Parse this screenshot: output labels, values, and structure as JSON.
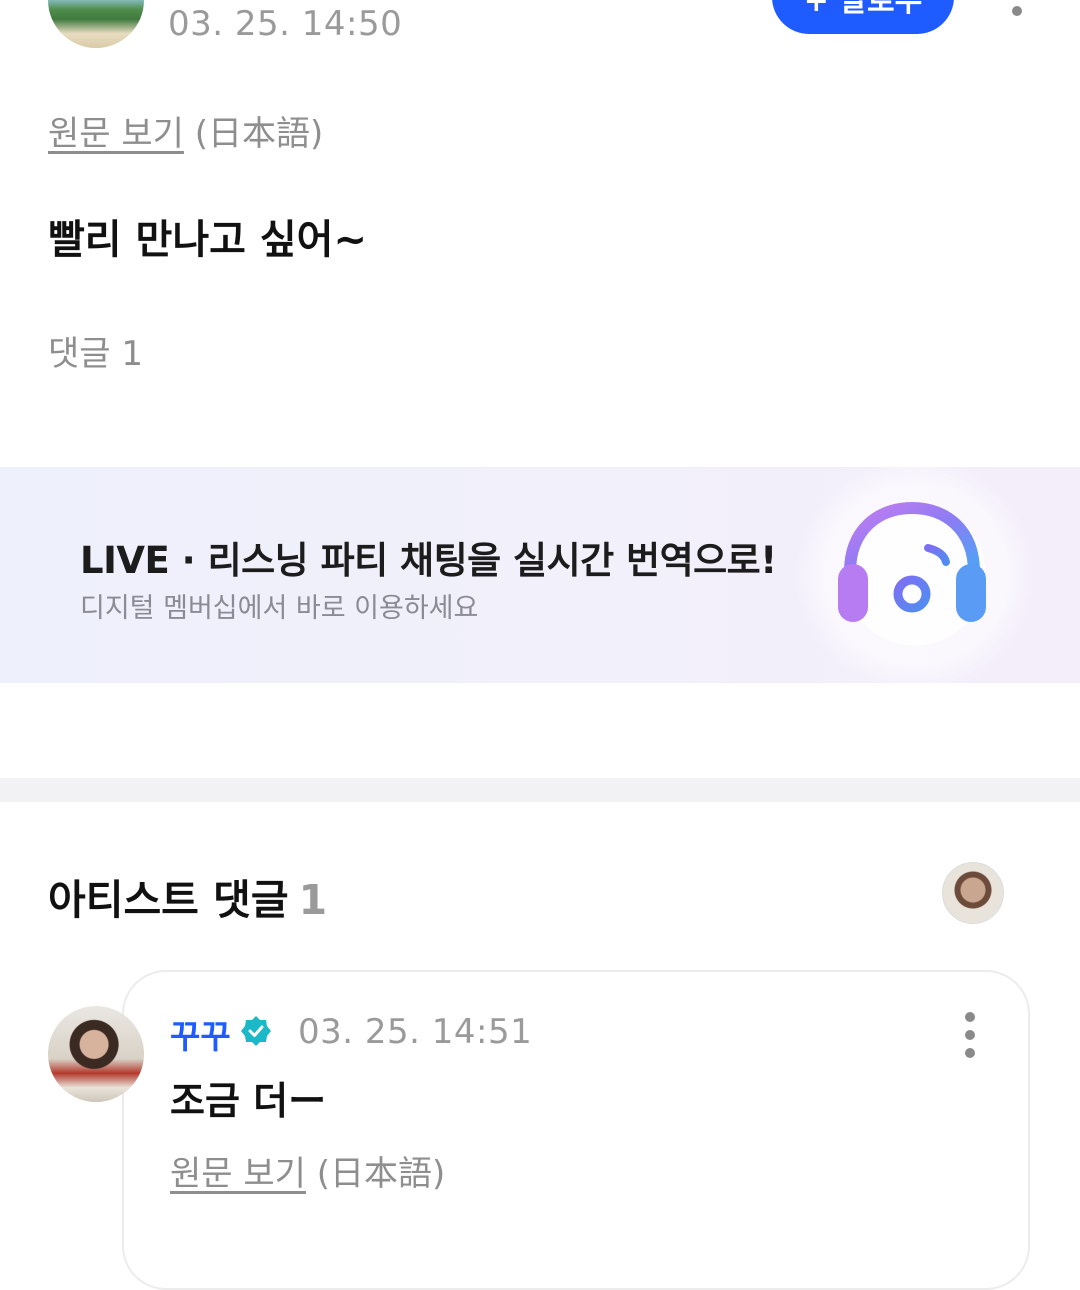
{
  "post": {
    "timestamp": "03. 25. 14:50",
    "follow_label": "+ 팔로우",
    "view_original": "원문 보기",
    "original_lang": "(日本語)",
    "body": "빨리 만나고 싶어~",
    "comments_label": "댓글 1"
  },
  "banner": {
    "title": "LIVE · 리스닝 파티 채팅을 실시간 번역으로!",
    "subtitle": "디지털 멤버십에서 바로 이용하세요",
    "icon": "headphones-music-icon"
  },
  "artist_comments": {
    "title": "아티스트 댓글",
    "count": "1",
    "comment": {
      "author": "꾸꾸",
      "timestamp": "03. 25. 14:51",
      "body": "조금 더ー",
      "view_original": "원문 보기",
      "original_lang": "(日本語)"
    }
  },
  "colors": {
    "accent": "#1f5cff",
    "verified": "#1bb8c8",
    "muted_text": "#8e8e8e"
  }
}
